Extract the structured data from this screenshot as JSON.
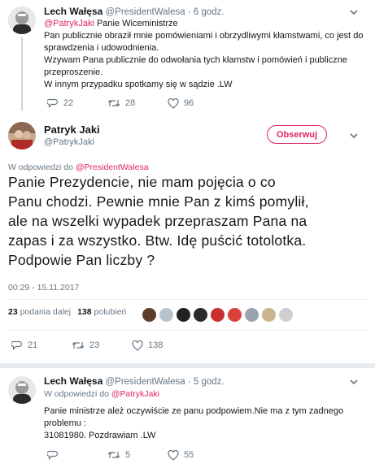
{
  "tweet1": {
    "author_name": "Lech Wałęsa",
    "author_handle": "@PresidentWalesa",
    "time": "· 6 godz.",
    "reply_mention": "@PatrykJaki",
    "reply_rest": " Panie Wiceministrze",
    "lines": [
      "Pan publicznie obraził mnie pomówieniami i obrzydliwymi kłamstwami, co jest do",
      "sprawdzenia i udowodnienia.",
      "Wzywam Pana publicznie do odwołania tych kłamstw i pomówień i publiczne",
      "przeproszenie.",
      "W innym przypadku spotkamy się w sądzie .LW"
    ],
    "replies": "22",
    "retweets": "28",
    "likes": "96"
  },
  "main": {
    "author_name": "Patryk Jaki",
    "author_handle": "@PatrykJaki",
    "follow_label": "Obserwuj",
    "in_reply_prefix": "W odpowiedzi do ",
    "in_reply_target": "@PresidentWalesa",
    "lines": [
      "Panie Prezydencie, nie mam pojęcia o co",
      "Panu chodzi. Pewnie mnie Pan z kimś pomylił,",
      "ale na wszelki wypadek przepraszam Pana na",
      "zapas i za wszystko. Btw. Idę puścić totolotka.",
      "Podpowie Pan liczby ?"
    ],
    "timestamp": "00:29 - 15.11.2017",
    "retweet_count": "23",
    "retweet_label": "podania dalej",
    "like_count": "138",
    "like_label": "polubień",
    "replies": "21",
    "retweets": "23",
    "likes": "138"
  },
  "tweet3": {
    "author_name": "Lech Wałęsa",
    "author_handle": "@PresidentWalesa",
    "time": "· 5 godz.",
    "in_reply_prefix": "W odpowiedzi do ",
    "in_reply_target": "@PatrykJaki",
    "lines": [
      "Panie ministrze ależ oczywiście ze panu podpowiem.Nie ma z tym zadnego",
      "problemu :",
      "31081980. Pozdrawiam .LW"
    ],
    "replies": "",
    "retweets": "5",
    "likes": "55"
  },
  "icons": [
    "reply-icon",
    "retweet-icon",
    "like-icon",
    "chevron-down-icon"
  ],
  "colors": {
    "accent": "#e0245e",
    "muted": "#657786",
    "divider": "#e6ecf0"
  }
}
